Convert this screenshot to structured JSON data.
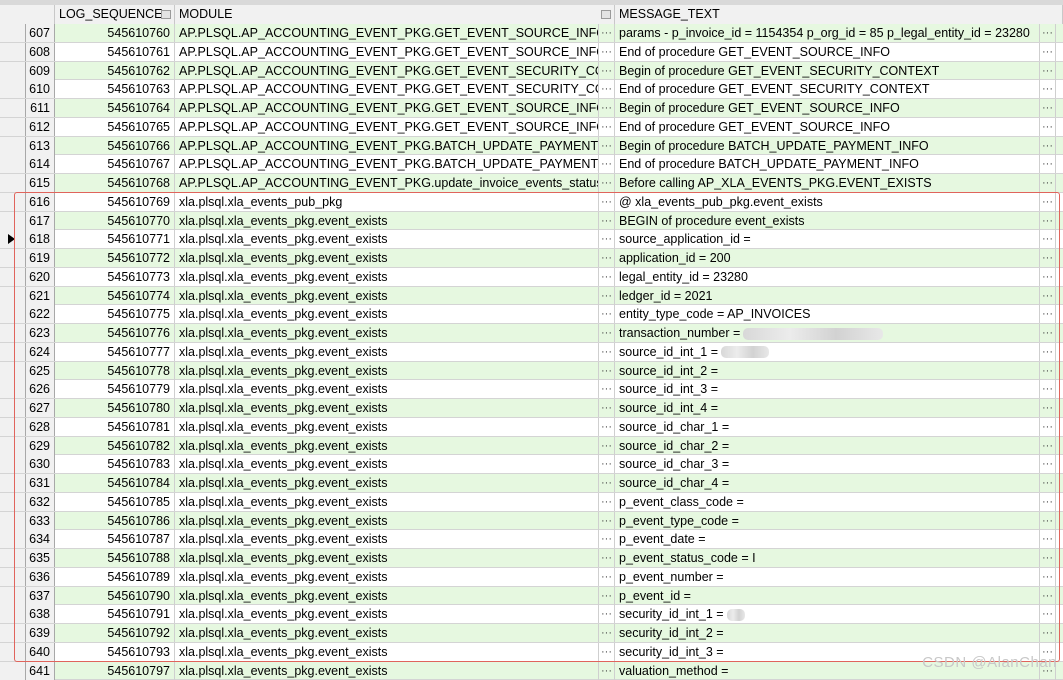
{
  "columns": {
    "seq": "LOG_SEQUENCE",
    "module": "MODULE",
    "message": "MESSAGE_TEXT"
  },
  "current_row": "618",
  "rows": [
    {
      "rn": "607",
      "seq": "545610760",
      "module": "AP.PLSQL.AP_ACCOUNTING_EVENT_PKG.GET_EVENT_SOURCE_INFO",
      "msg": "params -  p_invoice_id = 1154354 p_org_id = 85 p_legal_entity_id = 23280"
    },
    {
      "rn": "608",
      "seq": "545610761",
      "module": "AP.PLSQL.AP_ACCOUNTING_EVENT_PKG.GET_EVENT_SOURCE_INFO",
      "msg": "End of procedure GET_EVENT_SOURCE_INFO"
    },
    {
      "rn": "609",
      "seq": "545610762",
      "module": "AP.PLSQL.AP_ACCOUNTING_EVENT_PKG.GET_EVENT_SECURITY_CONTEXT",
      "msg": "Begin of procedure GET_EVENT_SECURITY_CONTEXT"
    },
    {
      "rn": "610",
      "seq": "545610763",
      "module": "AP.PLSQL.AP_ACCOUNTING_EVENT_PKG.GET_EVENT_SECURITY_CONTEXT",
      "msg": "End of procedure GET_EVENT_SECURITY_CONTEXT"
    },
    {
      "rn": "611",
      "seq": "545610764",
      "module": "AP.PLSQL.AP_ACCOUNTING_EVENT_PKG.GET_EVENT_SOURCE_INFO",
      "msg": "Begin of procedure GET_EVENT_SOURCE_INFO"
    },
    {
      "rn": "612",
      "seq": "545610765",
      "module": "AP.PLSQL.AP_ACCOUNTING_EVENT_PKG.GET_EVENT_SOURCE_INFO",
      "msg": "End of procedure GET_EVENT_SOURCE_INFO"
    },
    {
      "rn": "613",
      "seq": "545610766",
      "module": "AP.PLSQL.AP_ACCOUNTING_EVENT_PKG.BATCH_UPDATE_PAYMENT_INFO",
      "msg": "Begin of procedure BATCH_UPDATE_PAYMENT_INFO"
    },
    {
      "rn": "614",
      "seq": "545610767",
      "module": "AP.PLSQL.AP_ACCOUNTING_EVENT_PKG.BATCH_UPDATE_PAYMENT_INFO",
      "msg": "End of procedure BATCH_UPDATE_PAYMENT_INFO"
    },
    {
      "rn": "615",
      "seq": "545610768",
      "module": "AP.PLSQL.AP_ACCOUNTING_EVENT_PKG.update_invoice_events_status",
      "msg": "Before calling AP_XLA_EVENTS_PKG.EVENT_EXISTS"
    },
    {
      "rn": "616",
      "seq": "545610769",
      "module": "xla.plsql.xla_events_pub_pkg",
      "msg": "@ xla_events_pub_pkg.event_exists"
    },
    {
      "rn": "617",
      "seq": "545610770",
      "module": "xla.plsql.xla_events_pkg.event_exists",
      "msg": "BEGIN of procedure event_exists"
    },
    {
      "rn": "618",
      "seq": "545610771",
      "module": "xla.plsql.xla_events_pkg.event_exists",
      "msg": "source_application_id ="
    },
    {
      "rn": "619",
      "seq": "545610772",
      "module": "xla.plsql.xla_events_pkg.event_exists",
      "msg": "application_id = 200"
    },
    {
      "rn": "620",
      "seq": "545610773",
      "module": "xla.plsql.xla_events_pkg.event_exists",
      "msg": "legal_entity_id = 23280"
    },
    {
      "rn": "621",
      "seq": "545610774",
      "module": "xla.plsql.xla_events_pkg.event_exists",
      "msg": "ledger_id = 2021"
    },
    {
      "rn": "622",
      "seq": "545610775",
      "module": "xla.plsql.xla_events_pkg.event_exists",
      "msg": "entity_type_code = AP_INVOICES"
    },
    {
      "rn": "623",
      "seq": "545610776",
      "module": "xla.plsql.xla_events_pkg.event_exists",
      "msg": "transaction_number =",
      "blur": 140
    },
    {
      "rn": "624",
      "seq": "545610777",
      "module": "xla.plsql.xla_events_pkg.event_exists",
      "msg": "source_id_int_1 =",
      "blur": 48
    },
    {
      "rn": "625",
      "seq": "545610778",
      "module": "xla.plsql.xla_events_pkg.event_exists",
      "msg": "source_id_int_2 ="
    },
    {
      "rn": "626",
      "seq": "545610779",
      "module": "xla.plsql.xla_events_pkg.event_exists",
      "msg": "source_id_int_3 ="
    },
    {
      "rn": "627",
      "seq": "545610780",
      "module": "xla.plsql.xla_events_pkg.event_exists",
      "msg": "source_id_int_4 ="
    },
    {
      "rn": "628",
      "seq": "545610781",
      "module": "xla.plsql.xla_events_pkg.event_exists",
      "msg": "source_id_char_1 ="
    },
    {
      "rn": "629",
      "seq": "545610782",
      "module": "xla.plsql.xla_events_pkg.event_exists",
      "msg": "source_id_char_2 ="
    },
    {
      "rn": "630",
      "seq": "545610783",
      "module": "xla.plsql.xla_events_pkg.event_exists",
      "msg": "source_id_char_3 ="
    },
    {
      "rn": "631",
      "seq": "545610784",
      "module": "xla.plsql.xla_events_pkg.event_exists",
      "msg": "source_id_char_4 ="
    },
    {
      "rn": "632",
      "seq": "545610785",
      "module": "xla.plsql.xla_events_pkg.event_exists",
      "msg": "p_event_class_code ="
    },
    {
      "rn": "633",
      "seq": "545610786",
      "module": "xla.plsql.xla_events_pkg.event_exists",
      "msg": "p_event_type_code ="
    },
    {
      "rn": "634",
      "seq": "545610787",
      "module": "xla.plsql.xla_events_pkg.event_exists",
      "msg": "p_event_date ="
    },
    {
      "rn": "635",
      "seq": "545610788",
      "module": "xla.plsql.xla_events_pkg.event_exists",
      "msg": "p_event_status_code = I"
    },
    {
      "rn": "636",
      "seq": "545610789",
      "module": "xla.plsql.xla_events_pkg.event_exists",
      "msg": "p_event_number ="
    },
    {
      "rn": "637",
      "seq": "545610790",
      "module": "xla.plsql.xla_events_pkg.event_exists",
      "msg": "p_event_id ="
    },
    {
      "rn": "638",
      "seq": "545610791",
      "module": "xla.plsql.xla_events_pkg.event_exists",
      "msg": "security_id_int_1 =",
      "blur": 18
    },
    {
      "rn": "639",
      "seq": "545610792",
      "module": "xla.plsql.xla_events_pkg.event_exists",
      "msg": "security_id_int_2 ="
    },
    {
      "rn": "640",
      "seq": "545610793",
      "module": "xla.plsql.xla_events_pkg.event_exists",
      "msg": "security_id_int_3 ="
    },
    {
      "rn": "641",
      "seq": "545610797",
      "module": "xla.plsql.xla_events_pkg.event_exists",
      "msg": "valuation_method ="
    }
  ],
  "cell_button_glyph": "···",
  "watermark": "CSDN @AlanChan"
}
